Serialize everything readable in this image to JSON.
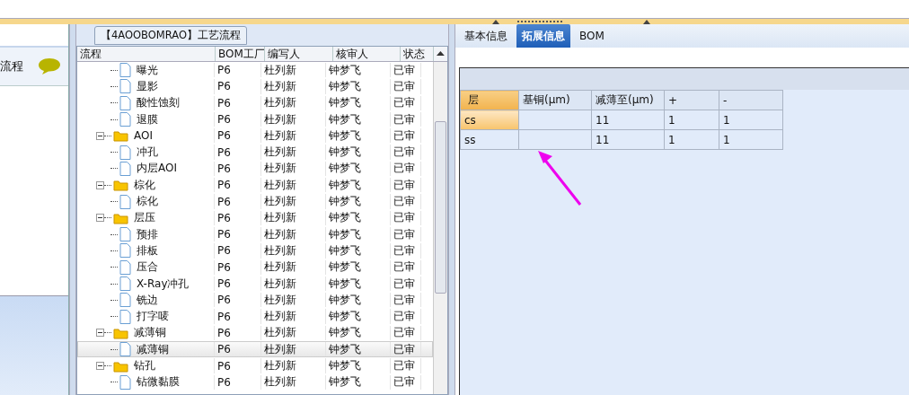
{
  "left_panel": {
    "title": "流程"
  },
  "process_panel": {
    "title": "【4AOOBOMRAO】工艺流程",
    "columns": [
      "流程",
      "BOM工厂",
      "编写人",
      "核审人",
      "状态"
    ],
    "tree": [
      {
        "kind": "file",
        "label": "曝光",
        "bom": "P6",
        "author": "杜列新",
        "reviewer": "钟梦飞",
        "status": "已审",
        "selected": false
      },
      {
        "kind": "file",
        "label": "显影",
        "bom": "P6",
        "author": "杜列新",
        "reviewer": "钟梦飞",
        "status": "已审",
        "selected": false
      },
      {
        "kind": "file",
        "label": "酸性蚀刻",
        "bom": "P6",
        "author": "杜列新",
        "reviewer": "钟梦飞",
        "status": "已审",
        "selected": false
      },
      {
        "kind": "file",
        "label": "退膜",
        "bom": "P6",
        "author": "杜列新",
        "reviewer": "钟梦飞",
        "status": "已审",
        "selected": false
      },
      {
        "kind": "folder",
        "label": "AOI",
        "bom": "P6",
        "author": "杜列新",
        "reviewer": "钟梦飞",
        "status": "已审",
        "selected": false,
        "expanded": true,
        "children": [
          {
            "kind": "file",
            "label": "冲孔",
            "bom": "P6",
            "author": "杜列新",
            "reviewer": "钟梦飞",
            "status": "已审",
            "selected": false
          },
          {
            "kind": "file",
            "label": "内层AOI",
            "bom": "P6",
            "author": "杜列新",
            "reviewer": "钟梦飞",
            "status": "已审",
            "selected": false
          }
        ]
      },
      {
        "kind": "folder",
        "label": "棕化",
        "bom": "P6",
        "author": "杜列新",
        "reviewer": "钟梦飞",
        "status": "已审",
        "selected": false,
        "expanded": true,
        "children": [
          {
            "kind": "file",
            "label": "棕化",
            "bom": "P6",
            "author": "杜列新",
            "reviewer": "钟梦飞",
            "status": "已审",
            "selected": false
          }
        ]
      },
      {
        "kind": "folder",
        "label": "层压",
        "bom": "P6",
        "author": "杜列新",
        "reviewer": "钟梦飞",
        "status": "已审",
        "selected": false,
        "expanded": true,
        "children": [
          {
            "kind": "file",
            "label": "预排",
            "bom": "P6",
            "author": "杜列新",
            "reviewer": "钟梦飞",
            "status": "已审",
            "selected": false
          },
          {
            "kind": "file",
            "label": "排板",
            "bom": "P6",
            "author": "杜列新",
            "reviewer": "钟梦飞",
            "status": "已审",
            "selected": false
          },
          {
            "kind": "file",
            "label": "压合",
            "bom": "P6",
            "author": "杜列新",
            "reviewer": "钟梦飞",
            "status": "已审",
            "selected": false
          },
          {
            "kind": "file",
            "label": "X-Ray冲孔",
            "bom": "P6",
            "author": "杜列新",
            "reviewer": "钟梦飞",
            "status": "已审",
            "selected": false
          },
          {
            "kind": "file",
            "label": "铣边",
            "bom": "P6",
            "author": "杜列新",
            "reviewer": "钟梦飞",
            "status": "已审",
            "selected": false
          },
          {
            "kind": "file",
            "label": "打字唛",
            "bom": "P6",
            "author": "杜列新",
            "reviewer": "钟梦飞",
            "status": "已审",
            "selected": false
          }
        ]
      },
      {
        "kind": "folder",
        "label": "减薄铜",
        "bom": "P6",
        "author": "杜列新",
        "reviewer": "钟梦飞",
        "status": "已审",
        "selected": false,
        "expanded": true,
        "children": [
          {
            "kind": "file",
            "label": "减薄铜",
            "bom": "P6",
            "author": "杜列新",
            "reviewer": "钟梦飞",
            "status": "已审",
            "selected": true
          }
        ]
      },
      {
        "kind": "folder",
        "label": "钻孔",
        "bom": "P6",
        "author": "杜列新",
        "reviewer": "钟梦飞",
        "status": "已审",
        "selected": false,
        "expanded": true,
        "children": [
          {
            "kind": "file",
            "label": "钻微黏膜",
            "bom": "P6",
            "author": "杜列新",
            "reviewer": "钟梦飞",
            "status": "已审",
            "selected": false
          }
        ]
      }
    ]
  },
  "detail_panel": {
    "tabs": [
      {
        "label": "基本信息",
        "selected": false
      },
      {
        "label": "拓展信息",
        "selected": true
      },
      {
        "label": "BOM",
        "selected": false
      }
    ],
    "table": {
      "columns": [
        "层",
        "基铜(μm)",
        "减薄至(μm)",
        "+",
        "-"
      ],
      "rows": [
        {
          "layer": "cs",
          "reduce_to": "11",
          "plus": "1",
          "minus": "1",
          "selected": true
        },
        {
          "layer": "ss",
          "reduce_to": "11",
          "plus": "1",
          "minus": "1",
          "selected": false
        }
      ]
    }
  }
}
